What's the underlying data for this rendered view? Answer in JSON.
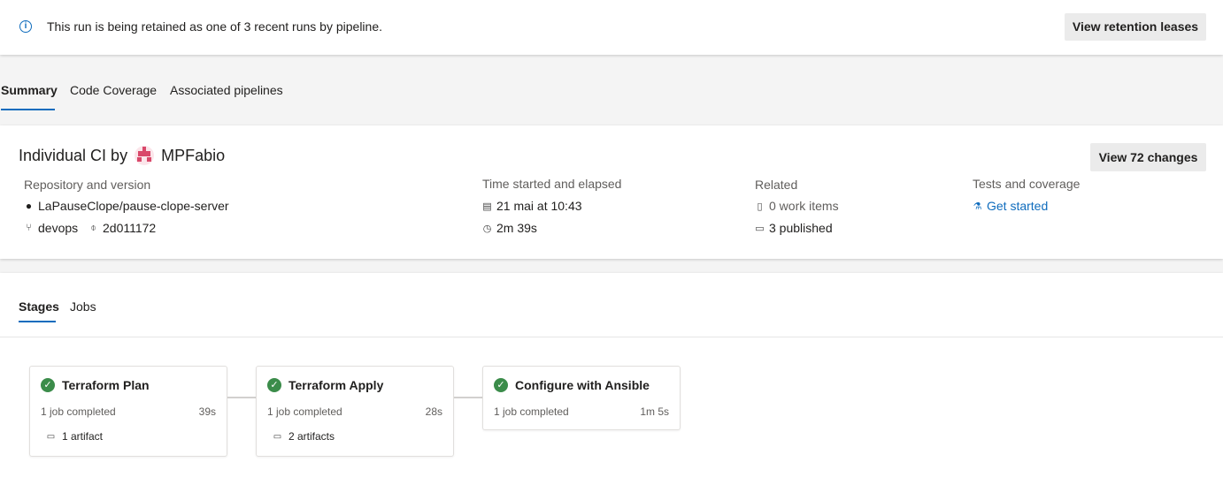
{
  "banner": {
    "icon": "info-icon",
    "message": "This run is being retained as one of 3 recent runs by pipeline.",
    "button_label": "View retention leases"
  },
  "tabs": [
    {
      "label": "Summary",
      "active": true
    },
    {
      "label": "Code Coverage",
      "active": false
    },
    {
      "label": "Associated pipelines",
      "active": false
    }
  ],
  "summary": {
    "title_prefix": "Individual CI by",
    "user": "MPFabio",
    "changes_button": "View 72 changes",
    "repository": {
      "heading": "Repository and version",
      "repo_name": "LaPauseClope/pause-clope-server",
      "branch": "devops",
      "commit": "2d011172"
    },
    "time": {
      "heading": "Time started and elapsed",
      "started": "21 mai at 10:43",
      "elapsed": "2m 39s"
    },
    "related": {
      "heading": "Related",
      "work_items": "0 work items",
      "published": "3 published"
    },
    "tests": {
      "heading": "Tests and coverage",
      "link": "Get started"
    }
  },
  "stages_section": {
    "tabs": [
      {
        "label": "Stages",
        "active": true
      },
      {
        "label": "Jobs",
        "active": false
      }
    ],
    "stages": [
      {
        "name": "Terraform Plan",
        "jobs": "1 job completed",
        "duration": "39s",
        "artifacts": "1 artifact",
        "status": "succeeded"
      },
      {
        "name": "Terraform Apply",
        "jobs": "1 job completed",
        "duration": "28s",
        "artifacts": "2 artifacts",
        "status": "succeeded"
      },
      {
        "name": "Configure with Ansible",
        "jobs": "1 job completed",
        "duration": "1m 5s",
        "artifacts": "",
        "status": "succeeded"
      }
    ]
  },
  "colors": {
    "accent": "#0f6cbd",
    "success": "#3b8c4a",
    "avatar": "#d9486a"
  }
}
